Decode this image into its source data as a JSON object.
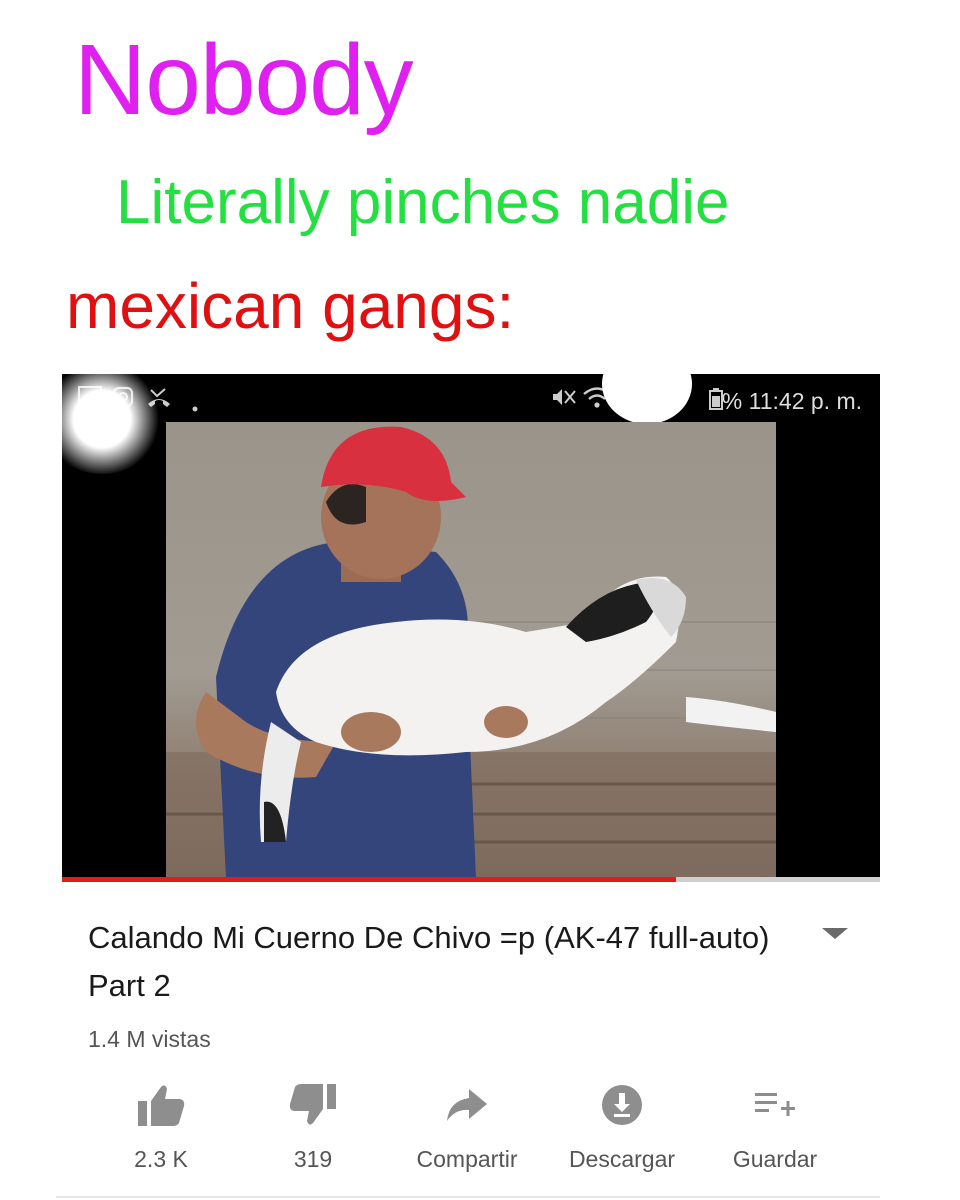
{
  "caption": {
    "line1": "Nobody",
    "line2": "Literally pinches nadie",
    "line3": "mexican gangs:",
    "colors": {
      "line1": "#e020f0",
      "line2": "#22e040",
      "line3": "#e01010"
    }
  },
  "status_bar": {
    "time": "%  11:42 p. m.",
    "left_icons": [
      "image-icon",
      "instagram-icon",
      "missed-call-icon",
      "dot-icon"
    ],
    "right_icons": [
      "mute-vibrate-icon",
      "wifi-icon",
      "battery-icon"
    ]
  },
  "player": {
    "progress": 0.75,
    "progress_color": "#e31b1b"
  },
  "video": {
    "title": "Calando Mi Cuerno De Chivo =p (AK-47 full-auto) Part 2",
    "views": "1.4 M vistas"
  },
  "actions": [
    {
      "icon": "thumbs-up-icon",
      "label": "2.3 K"
    },
    {
      "icon": "thumbs-down-icon",
      "label": "319"
    },
    {
      "icon": "share-icon",
      "label": "Compartir"
    },
    {
      "icon": "download-icon",
      "label": "Descargar"
    },
    {
      "icon": "playlist-add-icon",
      "label": "Guardar"
    }
  ]
}
